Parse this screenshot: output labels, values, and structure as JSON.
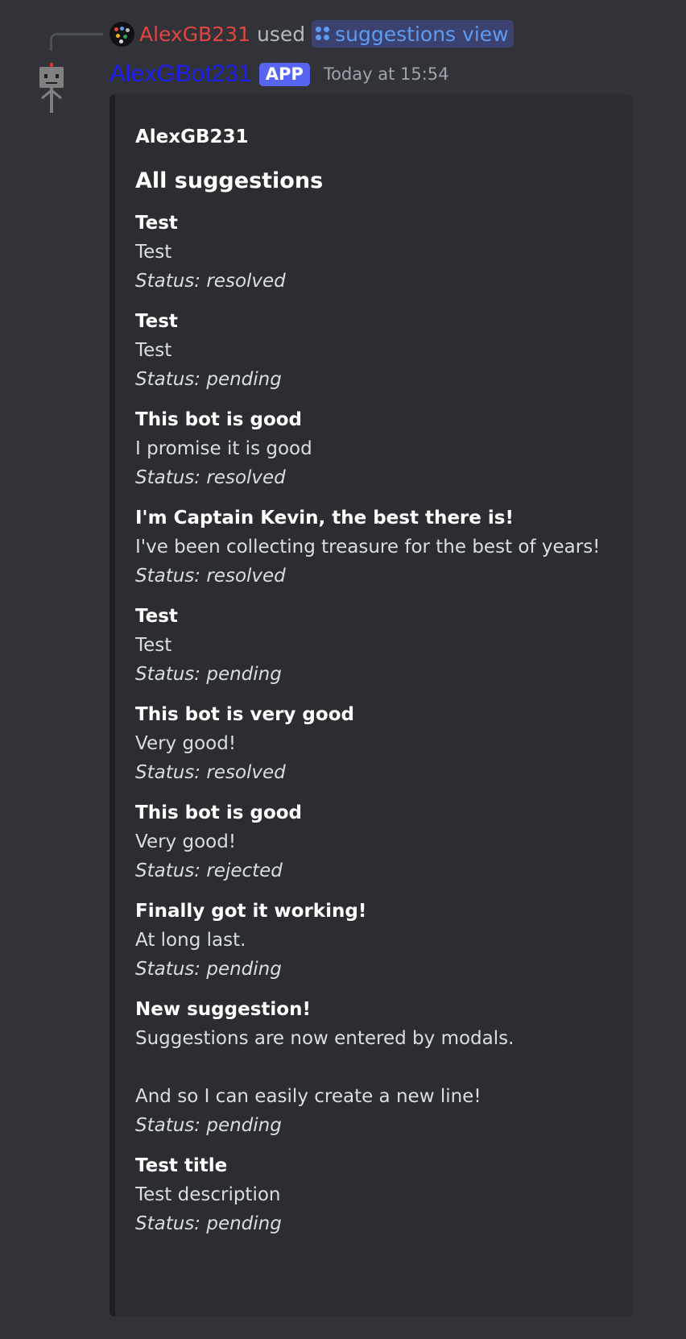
{
  "command_reply": {
    "user": "AlexGB231",
    "used_label": "used",
    "command": "suggestions view"
  },
  "header": {
    "bot_name": "AlexGBot231",
    "badge": "APP",
    "timestamp": "Today at 15:54"
  },
  "embed": {
    "author": "AlexGB231",
    "title": "All suggestions",
    "suggestions": [
      {
        "title": "Test",
        "description": "Test",
        "status": "Status: resolved"
      },
      {
        "title": "Test",
        "description": "Test",
        "status": "Status: pending"
      },
      {
        "title": "This bot is good",
        "description": "I promise it is good",
        "status": "Status: resolved"
      },
      {
        "title": "I'm Captain Kevin, the best there is!",
        "description": "I've been collecting treasure for the best of years!",
        "status": "Status: resolved"
      },
      {
        "title": "Test",
        "description": "Test",
        "status": "Status: pending"
      },
      {
        "title": "This bot is very good",
        "description": "Very good!",
        "status": "Status: resolved"
      },
      {
        "title": "This bot is good",
        "description": "Very good!",
        "status": "Status: rejected"
      },
      {
        "title": "Finally got it working!",
        "description": "At long last.",
        "status": "Status: pending"
      },
      {
        "title": "New suggestion!",
        "description": "Suggestions are now entered by modals.\n\nAnd so I can easily create a new line!",
        "status": "Status: pending"
      },
      {
        "title": "Test title",
        "description": "Test description",
        "status": "Status: pending"
      }
    ]
  },
  "colors": {
    "background": "#313338",
    "embed_background": "#2b2d31",
    "user_name": "#e0453f",
    "bot_name": "#1f1ff0",
    "command_chip": "#3c4270",
    "command_text": "#5d9bf0",
    "app_badge": "#5865f2"
  },
  "icons": {
    "command": "app-command-icon",
    "bot_avatar": "robot-avatar-icon",
    "user_avatar": "user-avatar-icon"
  }
}
